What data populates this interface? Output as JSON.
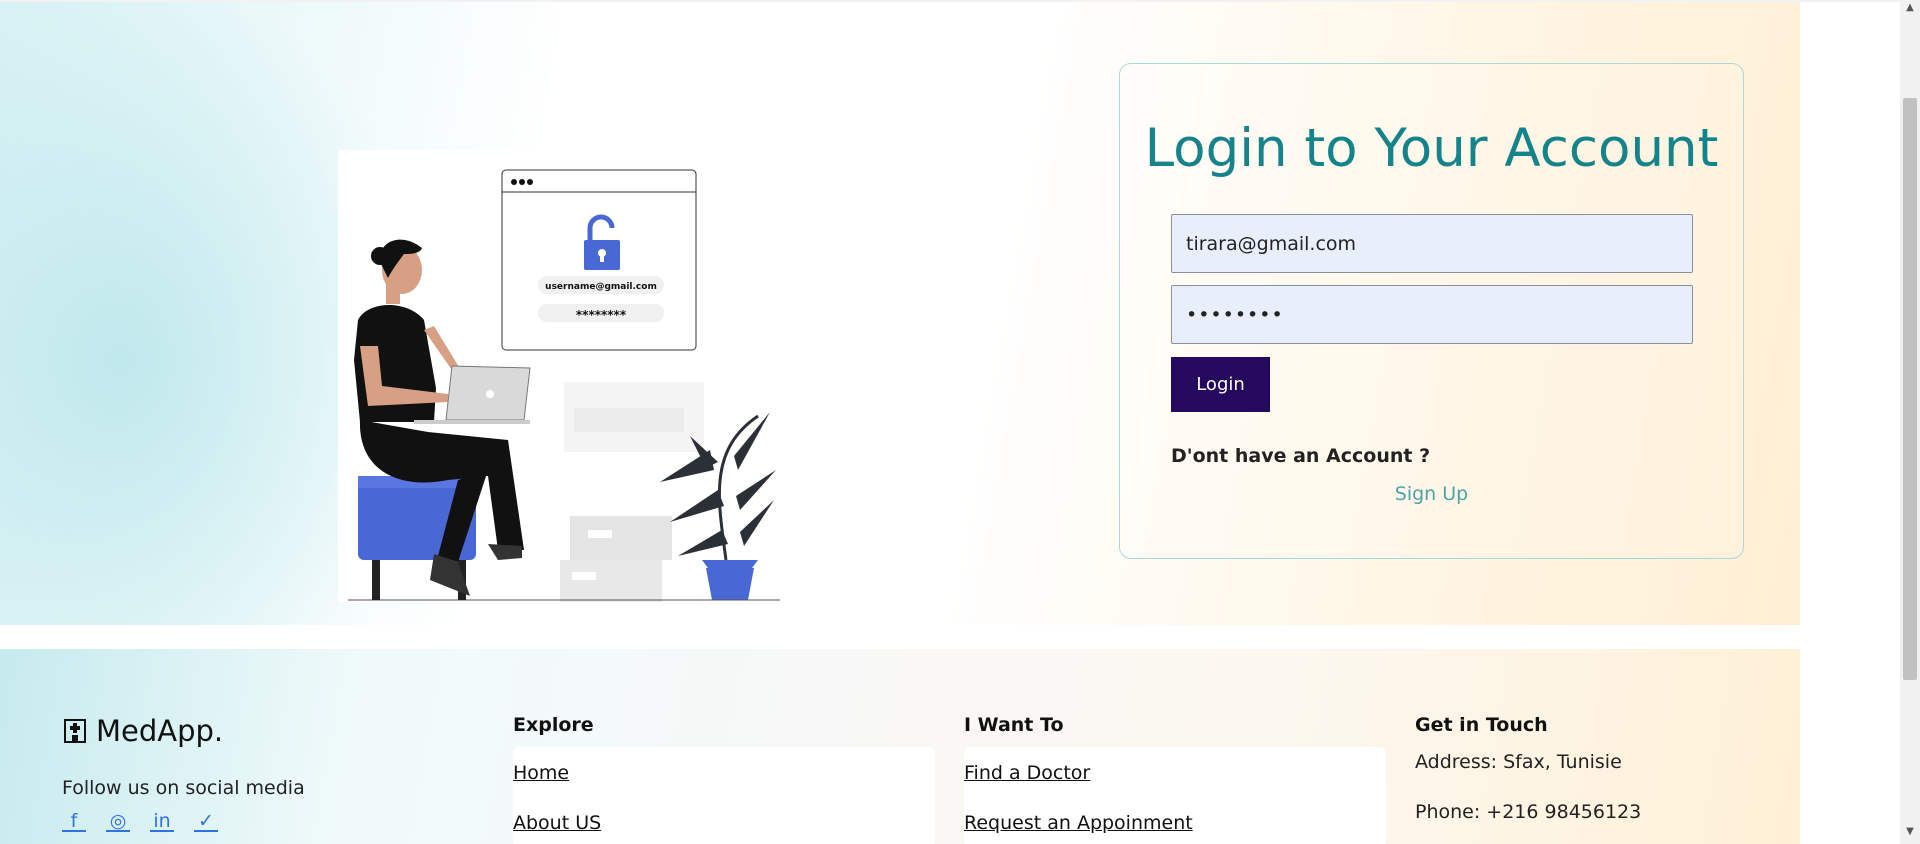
{
  "login": {
    "title": "Login to Your Account",
    "email_value": "tirara@gmail.com",
    "password_value": "••••••••",
    "button_label": "Login",
    "no_account_text": "D'ont have an Account ?",
    "signup_link": "Sign Up"
  },
  "illustration": {
    "username_text": "username@gmail.com",
    "password_text": "********"
  },
  "footer": {
    "brand": "MedApp.",
    "follow_text": "Follow us on social media",
    "socials": [
      "f",
      "◎",
      "in",
      "✓"
    ],
    "explore": {
      "title": "Explore",
      "links": [
        "Home",
        "About US"
      ]
    },
    "i_want_to": {
      "title": "I Want To",
      "links": [
        "Find a Doctor",
        "Request an Appoinment"
      ]
    },
    "get_in_touch": {
      "title": "Get in Touch",
      "address": "Address: Sfax, Tunisie",
      "phone": "Phone: +216 98456123"
    }
  },
  "colors": {
    "title": "#14838a",
    "button": "#24095e",
    "input_bg": "#e8effb",
    "link": "#4ca3a9",
    "social": "#2f73e0",
    "figure_blue": "#4a67d6"
  },
  "icons": {
    "brand": "hospital-icon",
    "facebook": "facebook-icon",
    "instagram": "instagram-icon",
    "linkedin": "linkedin-icon",
    "twitter": "twitter-icon",
    "lock": "unlock-icon"
  }
}
